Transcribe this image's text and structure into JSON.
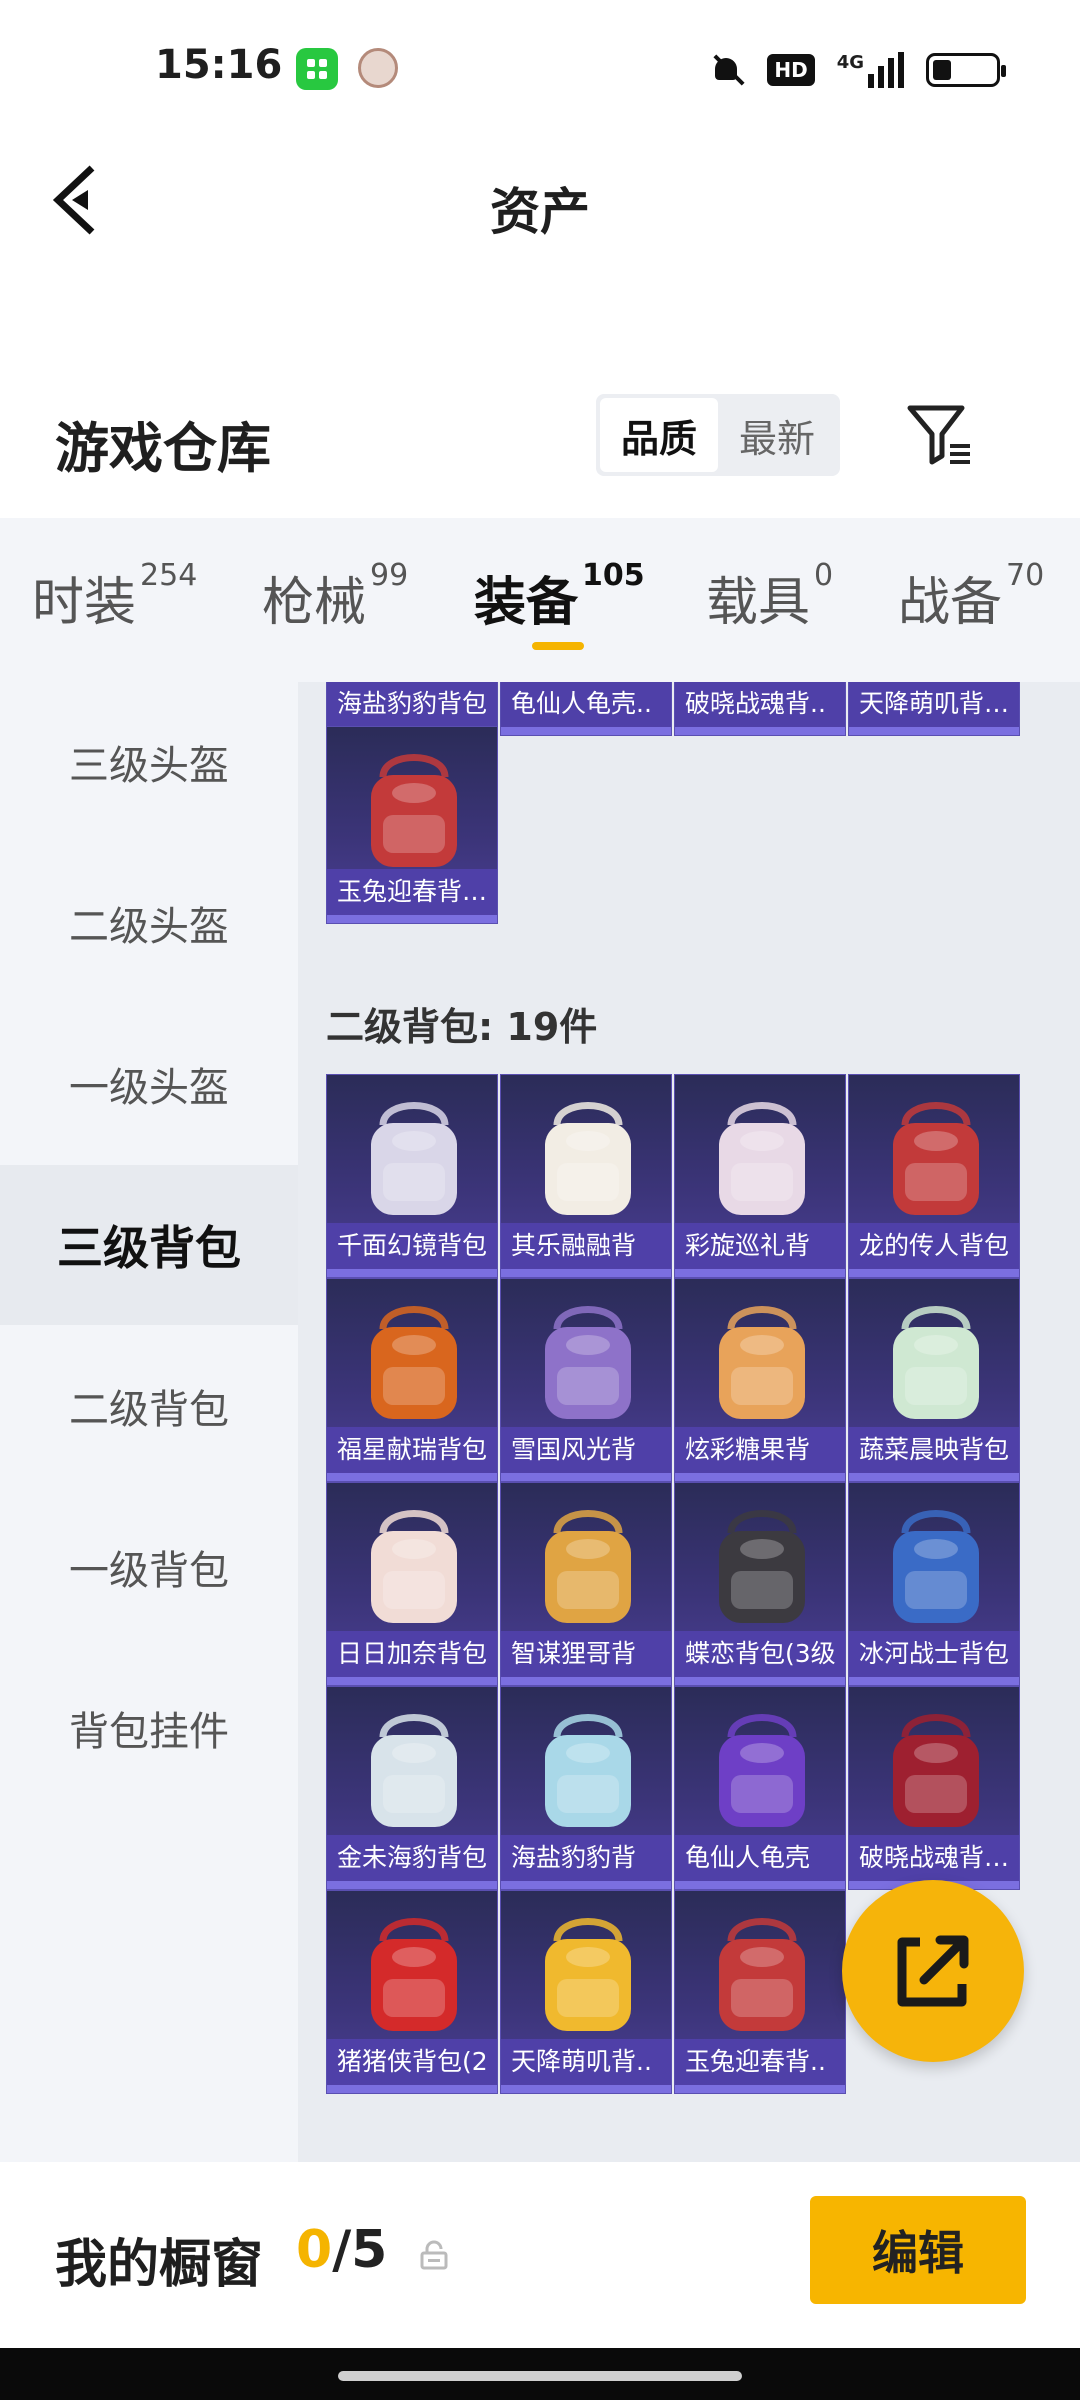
{
  "status_bar": {
    "time": "15:16",
    "hd": "HD",
    "network": "4G"
  },
  "header": {
    "title": "资产"
  },
  "warehouse": {
    "title": "游戏仓库",
    "sort_options": [
      "品质",
      "最新"
    ],
    "active_sort": "品质"
  },
  "tabs": [
    {
      "label": "时装",
      "count": "254"
    },
    {
      "label": "枪械",
      "count": "99"
    },
    {
      "label": "装备",
      "count": "105",
      "active": true
    },
    {
      "label": "载具",
      "count": "0"
    },
    {
      "label": "战备",
      "count": "70"
    }
  ],
  "sidebar": {
    "items": [
      "三级头盔",
      "二级头盔",
      "一级头盔",
      "三级背包",
      "二级背包",
      "一级背包",
      "背包挂件"
    ],
    "active": "三级背包"
  },
  "top_partial_row": [
    "海盐豹豹背包",
    "龟仙人龟壳..",
    "破晓战魂背..",
    "天降萌叽背包..."
  ],
  "single_item": "玉兔迎春背包...",
  "section": {
    "title": "二级背包: 19件"
  },
  "grid_items": [
    {
      "label": "千面幻镜背包",
      "color": "#d9d6e8"
    },
    {
      "label": "其乐融融背",
      "color": "#f2ede4"
    },
    {
      "label": "彩旋巡礼背",
      "color": "#e8d9e6"
    },
    {
      "label": "龙的传人背包",
      "color": "#c23a3a"
    },
    {
      "label": "福星献瑞背包",
      "color": "#d9661e"
    },
    {
      "label": "雪国风光背",
      "color": "#8e72c9"
    },
    {
      "label": "炫彩糖果背",
      "color": "#e8a35a"
    },
    {
      "label": "蔬菜晨映背包",
      "color": "#cfe8d2"
    },
    {
      "label": "日日加奈背包",
      "color": "#f1dcd6"
    },
    {
      "label": "智谋狸哥背",
      "color": "#e0a443"
    },
    {
      "label": "蝶恋背包(3级",
      "color": "#3c3a40"
    },
    {
      "label": "冰河战士背包",
      "color": "#3a6bc6"
    },
    {
      "label": "金未海豹背包",
      "color": "#d8e3ea"
    },
    {
      "label": "海盐豹豹背",
      "color": "#a9d8e8"
    },
    {
      "label": "龟仙人龟壳",
      "color": "#6e3fc6"
    },
    {
      "label": "破晓战魂背包...",
      "color": "#9e2030"
    },
    {
      "label": "猪猪侠背包(2",
      "color": "#d42a2a"
    },
    {
      "label": "天降萌叽背..",
      "color": "#f0b92e"
    },
    {
      "label": "玉兔迎春背..",
      "color": "#c33a3a"
    }
  ],
  "bottom": {
    "showcase_label": "我的橱窗",
    "showcase_current": "0",
    "showcase_total": "/5",
    "edit_label": "编辑"
  }
}
